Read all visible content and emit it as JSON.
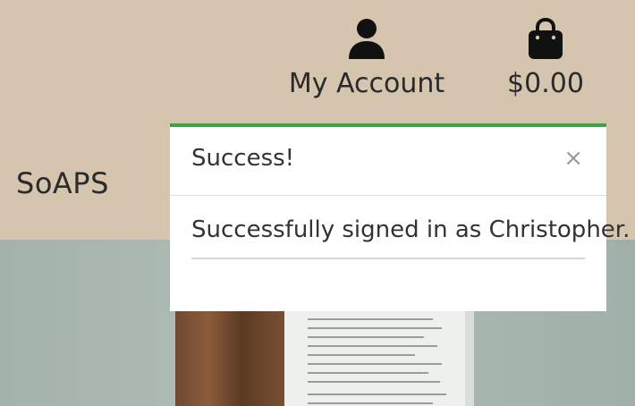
{
  "header": {
    "brand": "SoAPS",
    "account": {
      "label": "My Account",
      "icon": "user-icon"
    },
    "bag": {
      "total": "$0.00",
      "icon": "shopping-bag-icon"
    }
  },
  "toast": {
    "title": "Success!",
    "close_glyph": "×",
    "message": "Successfully signed in as Christopher.",
    "accent_color": "#3fa142"
  }
}
